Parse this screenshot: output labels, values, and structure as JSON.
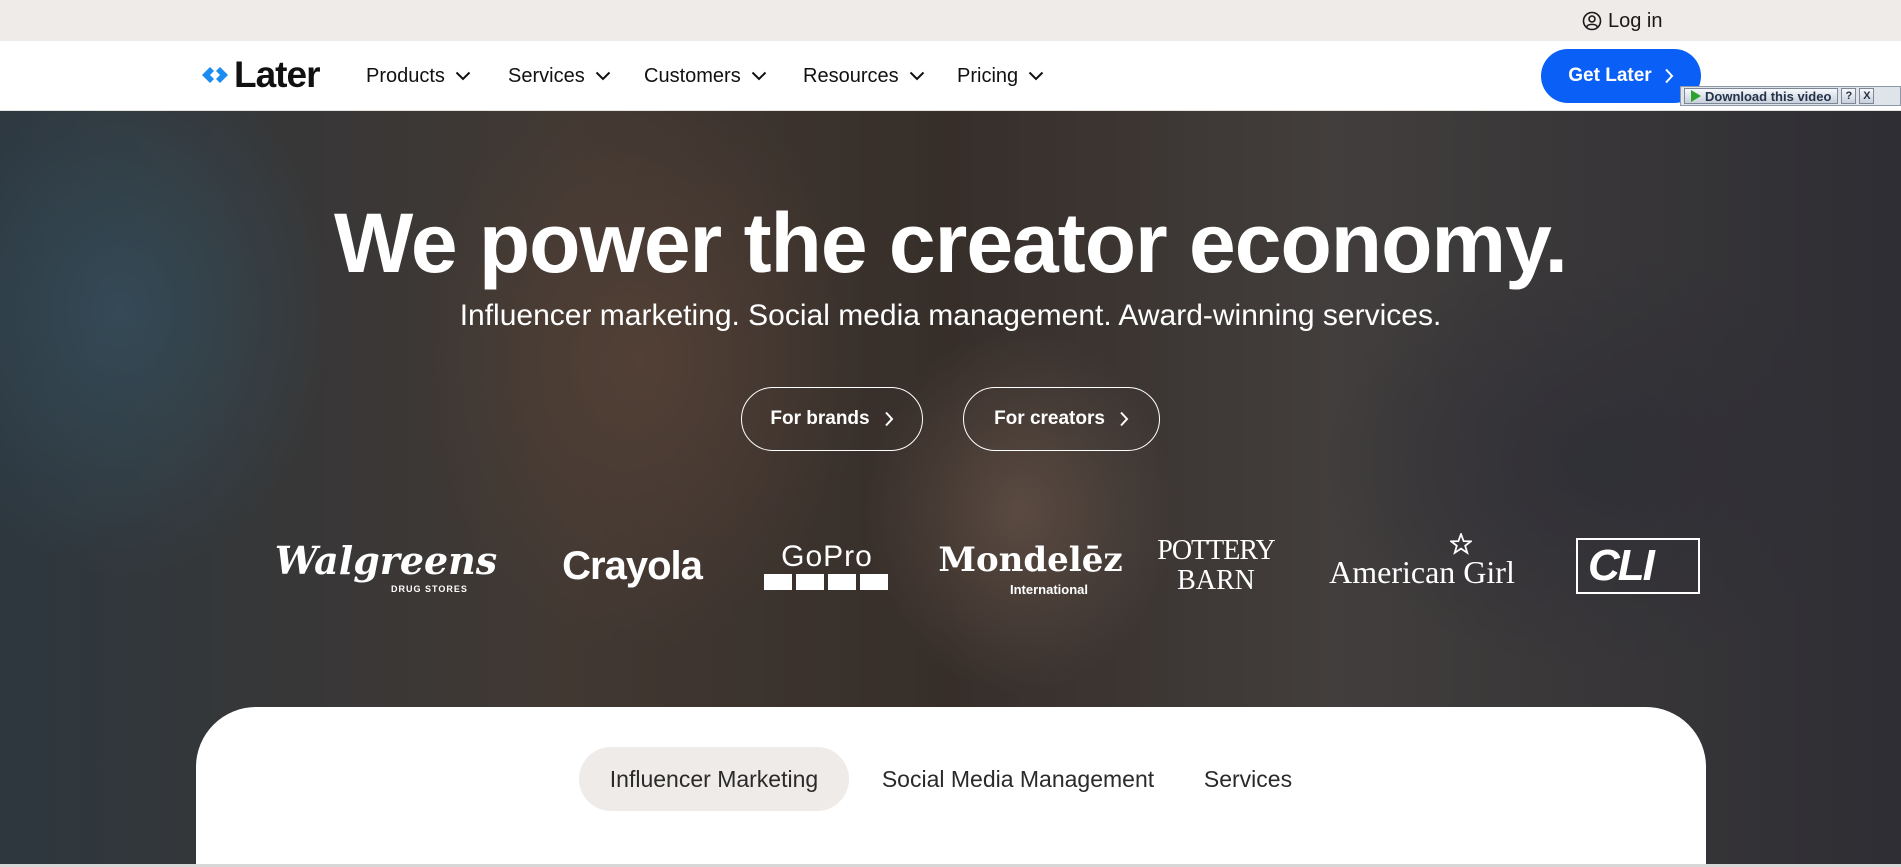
{
  "utility_bar": {
    "login_label": "Log in"
  },
  "nav": {
    "logo_text": "Later",
    "items": [
      {
        "label": "Products"
      },
      {
        "label": "Services"
      },
      {
        "label": "Customers"
      },
      {
        "label": "Resources"
      },
      {
        "label": "Pricing"
      }
    ],
    "cta_label": "Get Later"
  },
  "hero": {
    "title": "We power the creator economy.",
    "subtitle": "Influencer marketing. Social media management. Award-winning services.",
    "buttons": [
      {
        "label": "For brands"
      },
      {
        "label": "For creators"
      }
    ],
    "brands": [
      {
        "name": "Walgreens",
        "sub": "DRUG STORES"
      },
      {
        "name": "Crayola"
      },
      {
        "name": "GoPro"
      },
      {
        "name": "Mondelēz",
        "sub": "International"
      },
      {
        "name": "POTTERY",
        "sub": "BARN"
      },
      {
        "name": "American Girl"
      },
      {
        "name": "CLI"
      }
    ]
  },
  "tabs": [
    {
      "label": "Influencer Marketing",
      "active": true
    },
    {
      "label": "Social Media Management"
    },
    {
      "label": "Services"
    }
  ],
  "download_widget": {
    "label": "Download this video",
    "help": "?",
    "close": "X"
  },
  "colors": {
    "accent": "#0a5ff7",
    "logo_blue": "#1b8cf0",
    "utility_bg": "#efebe8"
  }
}
